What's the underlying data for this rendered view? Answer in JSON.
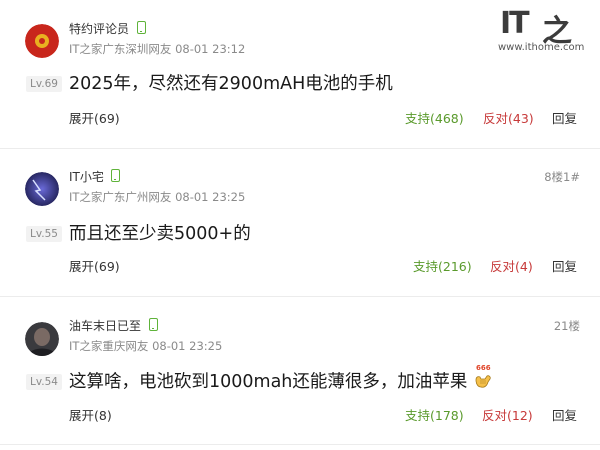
{
  "watermark": {
    "brand_it": "IT",
    "brand_cn": "之",
    "url": "www.ithome.com"
  },
  "comments": [
    {
      "username": "特约评论员",
      "meta": "IT之家广东深圳网友 08-01 23:12",
      "floor": "",
      "level": "Lv.69",
      "content": "2025年，尽然还有2900mAH电池的手机",
      "expand": "展开(69)",
      "support": "支持(468)",
      "oppose": "反对(43)",
      "reply": "回复"
    },
    {
      "username": "IT小宅",
      "meta": "IT之家广东广州网友 08-01 23:25",
      "floor": "8楼1#",
      "level": "Lv.55",
      "content": "而且还至少卖5000+的",
      "expand": "展开(69)",
      "support": "支持(216)",
      "oppose": "反对(4)",
      "reply": "回复"
    },
    {
      "username": "油车末日已至",
      "meta": "IT之家重庆网友 08-01 23:25",
      "floor": "21楼",
      "level": "Lv.54",
      "content": "这算啥，电池砍到1000mah还能薄很多，加油苹果",
      "emoji_text": "666",
      "expand": "展开(8)",
      "support": "支持(178)",
      "oppose": "反对(12)",
      "reply": "回复"
    }
  ],
  "colors": {
    "support": "#5a9a2c",
    "oppose": "#c73a3a",
    "device_icon": "#5fb33a"
  }
}
